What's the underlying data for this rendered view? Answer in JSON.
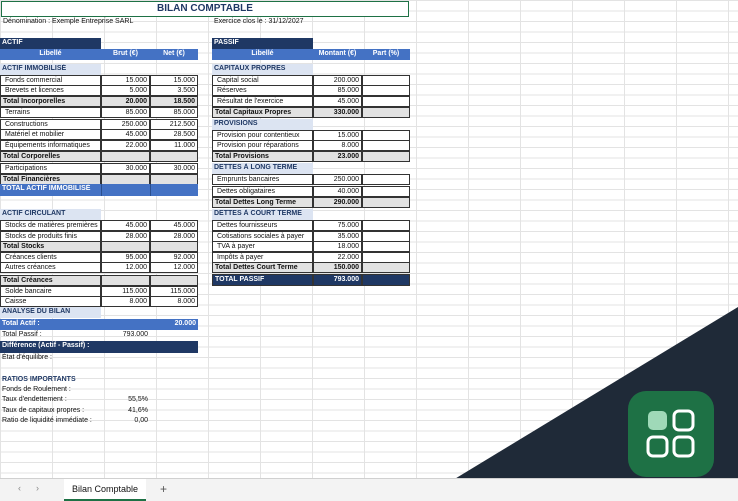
{
  "app": {
    "accent": "#1e7145",
    "dark": "#1f3864",
    "header_blue": "#4472c4"
  },
  "title": "BILAN COMPTABLE",
  "denomination": "Dénomination : Exemple Entreprise SARL",
  "exercice": "Exercice clos le : 31/12/2027",
  "actif": {
    "title": "ACTIF",
    "headers": [
      "Libellé",
      "Brut (€)",
      "Net (€)"
    ],
    "immo_title": "ACTIF IMMOBILISÉ",
    "r1": [
      "Fonds commercial",
      "15.000",
      "15.000"
    ],
    "r2": [
      "Brevets et licences",
      "5.000",
      "3.500"
    ],
    "r3": [
      "Total Incorporelles",
      "20.000",
      "18.500"
    ],
    "r4": [
      "Terrains",
      "85.000",
      "85.000"
    ],
    "r5": [
      "Constructions",
      "250.000",
      "212.500"
    ],
    "r6": [
      "Matériel et mobilier",
      "45.000",
      "28.500"
    ],
    "r7": [
      "Équipements informatiques",
      "22.000",
      "11.000"
    ],
    "r8": [
      "Total Corporelles"
    ],
    "r9": [
      "Participations",
      "30.000",
      "30.000"
    ],
    "r10": [
      "Total Financières"
    ],
    "total_immo": "TOTAL ACTIF IMMOBILISÉ",
    "circ_title": "ACTIF CIRCULANT",
    "c1": [
      "Stocks de matières premières",
      "45.000",
      "45.000"
    ],
    "c2": [
      "Stocks de produits finis",
      "28.000",
      "28.000"
    ],
    "c3": [
      "Total Stocks"
    ],
    "c4": [
      "Créances clients",
      "95.000",
      "92.000"
    ],
    "c5": [
      "Autres créances",
      "12.000",
      "12.000"
    ],
    "c6": [
      "Total Créances"
    ],
    "c7": [
      "Solde bancaire",
      "115.000",
      "115.000"
    ],
    "c8": [
      "Caisse",
      "8.000",
      "8.000"
    ]
  },
  "analyse": {
    "title": "ANALYSE DU BILAN",
    "total_actif": [
      "Total Actif :",
      "20.000"
    ],
    "total_passif": [
      "Total Passif :",
      "793.000"
    ],
    "difference": "Différence (Actif - Passif) :",
    "equilibre": "État d'équilibre :"
  },
  "ratios": {
    "title": "RATIOS IMPORTANTS",
    "r1": [
      "Fonds de Roulement :",
      ""
    ],
    "r2": [
      "Taux d'endettement :",
      "55,5%"
    ],
    "r3": [
      "Taux de capitaux propres :",
      "41,6%"
    ],
    "r4": [
      "Ratio de liquidité immédiate :",
      "0,00"
    ]
  },
  "passif": {
    "title": "PASSIF",
    "headers": [
      "Libellé",
      "Montant (€)",
      "Part (%)"
    ],
    "cp_title": "CAPITAUX PROPRES",
    "p1": [
      "Capital social",
      "200.000"
    ],
    "p2": [
      "Réserves",
      "85.000"
    ],
    "p3": [
      "Résultat de l'exercice",
      "45.000"
    ],
    "p4": [
      "Total Capitaux Propres",
      "330.000"
    ],
    "prov_title": "PROVISIONS",
    "p5": [
      "Provision pour contentieux",
      "15.000"
    ],
    "p6": [
      "Provision pour réparations",
      "8.000"
    ],
    "p7": [
      "Total Provisions",
      "23.000"
    ],
    "dlt_title": "DETTES À LONG TERME",
    "p8": [
      "Emprunts bancaires",
      "250.000"
    ],
    "p9": [
      "Dettes obligataires",
      "40.000"
    ],
    "p10": [
      "Total Dettes Long Terme",
      "290.000"
    ],
    "dct_title": "DETTES À COURT TERME",
    "p11": [
      "Dettes fournisseurs",
      "75.000"
    ],
    "p12": [
      "Cotisations sociales à payer",
      "35.000"
    ],
    "p13": [
      "TVA à payer",
      "18.000"
    ],
    "p14": [
      "Impôts à payer",
      "22.000"
    ],
    "p15": [
      "Total Dettes Court Terme",
      "150.000"
    ],
    "total": [
      "TOTAL PASSIF",
      "793.000"
    ]
  },
  "tabs": {
    "sheet": "Bilan Comptable",
    "add": "+",
    "prev": "‹",
    "next": "›"
  }
}
